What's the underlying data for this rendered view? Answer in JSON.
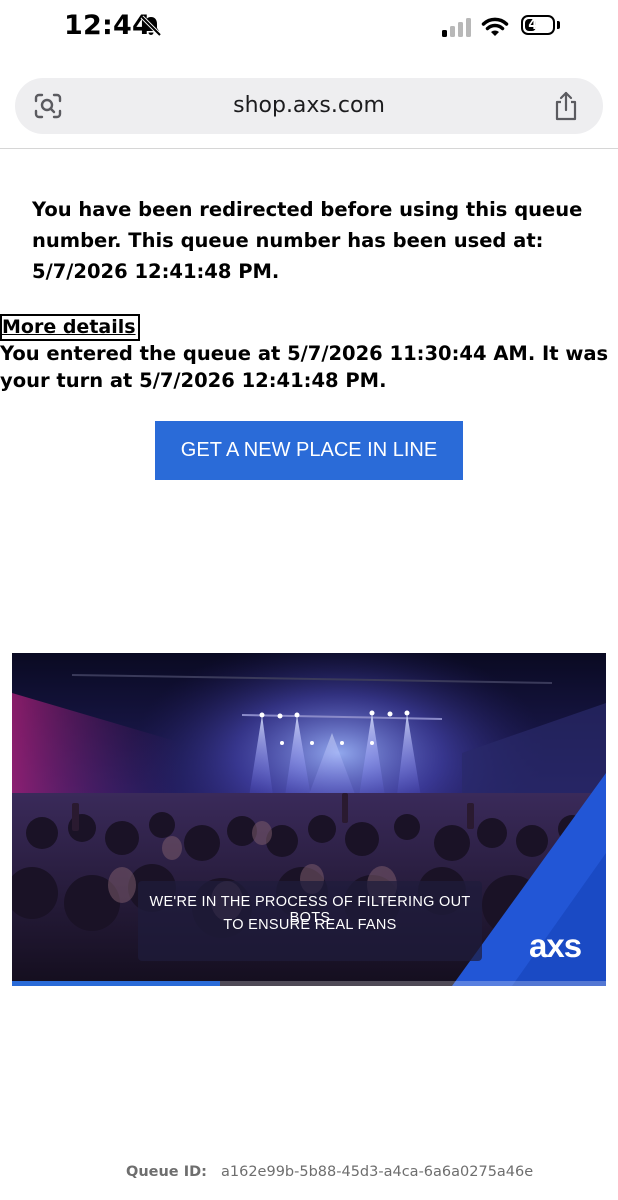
{
  "status_bar": {
    "time": "12:44",
    "battery": "41",
    "battery_level": 0.41,
    "icons": [
      "bell-slash-icon",
      "cellular-signal-icon",
      "wifi-icon",
      "battery-icon"
    ]
  },
  "browser": {
    "url": "shop.axs.com",
    "icons": [
      "visual-lookup-icon",
      "share-icon"
    ]
  },
  "main": {
    "redirect_message": "You have been redirected before using this queue number. This queue number has been used at: 5/7/2026 12:41:48 PM.",
    "more_details_label": "More details",
    "queue_details": "You entered the queue at 5/7/2026 11:30:44 AM. It was your turn at 5/7/2026 12:41:48 PM.",
    "new_place_button": "GET A NEW PLACE IN LINE"
  },
  "promo": {
    "caption_line_1": "WE'RE IN THE PROCESS OF FILTERING OUT BOTS",
    "caption_line_2": "TO ENSURE REAL FANS",
    "logo_text": "axs",
    "progress": 0.35
  },
  "footer": {
    "queue_id_label": "Queue ID:",
    "queue_id_value": "a162e99b-5b88-45d3-a4ca-6a6a0275a46e"
  },
  "colors": {
    "button_blue": "#2a6bd8",
    "accent_blue": "#2a6bd8"
  }
}
